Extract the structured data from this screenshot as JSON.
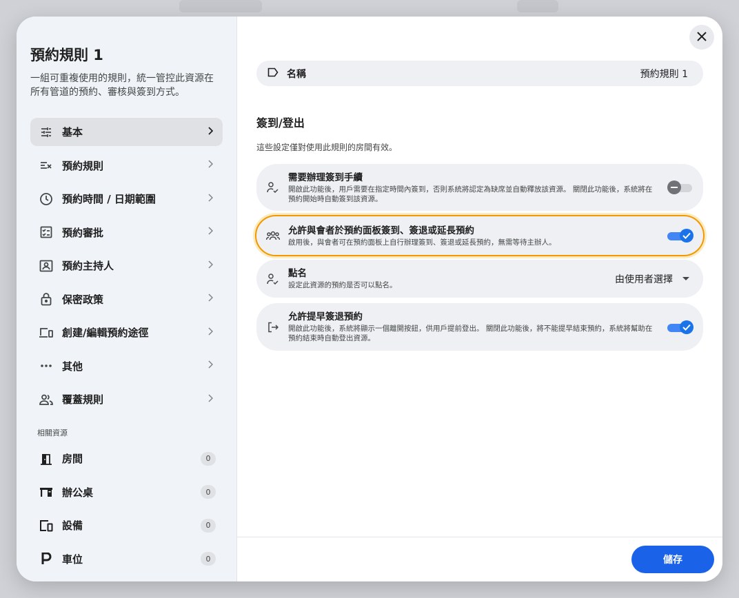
{
  "sidebar": {
    "title": "預約規則 1",
    "description": "一組可重複使用的規則，統一管控此資源在所有管道的預約、審核與簽到方式。",
    "items": [
      {
        "label": "基本",
        "icon": "sliders-icon"
      },
      {
        "label": "預約規則",
        "icon": "rules-checklist-icon"
      },
      {
        "label": "預約時間 / 日期範圍",
        "icon": "clock-icon"
      },
      {
        "label": "預約審批",
        "icon": "approval-checklist-icon"
      },
      {
        "label": "預約主持人",
        "icon": "host-badge-icon"
      },
      {
        "label": "保密政策",
        "icon": "lock-icon"
      },
      {
        "label": "創建/編輯預約途徑",
        "icon": "devices-icon"
      },
      {
        "label": "其他",
        "icon": "more-horizontal-icon"
      },
      {
        "label": "覆蓋規則",
        "icon": "people-icon"
      }
    ],
    "resources_label": "相關資源",
    "resources": [
      {
        "label": "房間",
        "count": "0",
        "icon": "door-icon"
      },
      {
        "label": "辦公桌",
        "count": "0",
        "icon": "desk-icon"
      },
      {
        "label": "設備",
        "count": "0",
        "icon": "device-icon"
      },
      {
        "label": "車位",
        "count": "0",
        "icon": "parking-icon"
      }
    ]
  },
  "main": {
    "name_label": "名稱",
    "name_value": "預約規則 1",
    "section_title": "簽到/登出",
    "section_desc": "這些設定僅對使用此規則的房間有效。",
    "options": [
      {
        "title": "需要辦理簽到手續",
        "desc": "開啟此功能後，用戶需要在指定時間內簽到，否則系統將認定為缺席並自動釋放該資源。 關閉此功能後，系統將在預約開始時自動簽到該資源。",
        "toggle": "off"
      },
      {
        "title": "允許與會者於預約面板簽到、簽退或延長預約",
        "desc": "啟用後，與會者可在預約面板上自行辦理簽到、簽退或延長預約，無需等待主辦人。",
        "toggle": "on"
      },
      {
        "title": "點名",
        "desc": "設定此資源的預約是否可以點名。",
        "select_value": "由使用者選擇"
      },
      {
        "title": "允許提早簽退預約",
        "desc": "開啟此功能後，系統將顯示一個離開按鈕，供用戶提前登出。 關閉此功能後，將不能提早結束預約，系統將幫助在預約結束時自動登出資源。",
        "toggle": "on"
      }
    ],
    "save_label": "儲存"
  },
  "colors": {
    "accent": "#1a73e8",
    "highlight": "#f29900",
    "sidebar_bg": "#f0f3f8"
  }
}
